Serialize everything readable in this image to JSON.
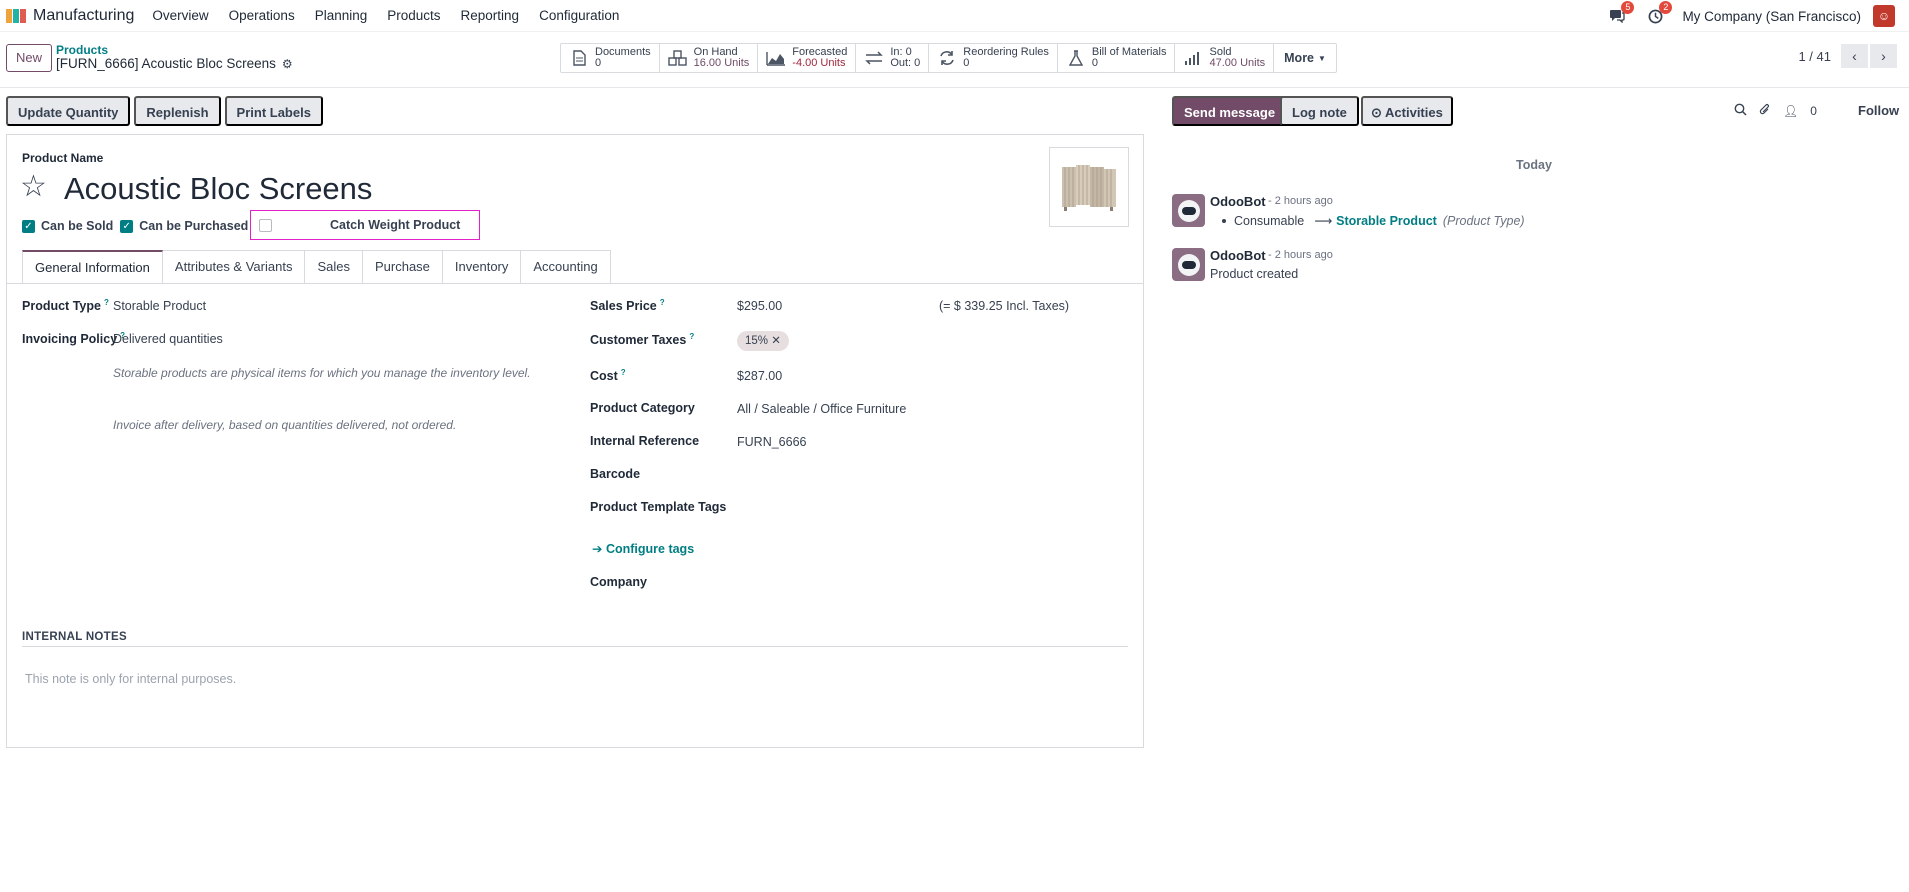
{
  "navbar": {
    "app_name": "Manufacturing",
    "menu": [
      "Overview",
      "Operations",
      "Planning",
      "Products",
      "Reporting",
      "Configuration"
    ],
    "messages_badge": "5",
    "activities_badge": "2",
    "company": "My Company (San Francisco)"
  },
  "control": {
    "new_label": "New",
    "breadcrumb_parent": "Products",
    "breadcrumb_current": "[FURN_6666] Acoustic Bloc Screens",
    "pager": "1 / 41",
    "smart_buttons": {
      "documents": {
        "label": "Documents",
        "value": "0"
      },
      "on_hand": {
        "label": "On Hand",
        "value": "16.00 Units"
      },
      "forecasted": {
        "label": "Forecasted",
        "value": "-4.00 Units"
      },
      "in_out": {
        "in": "In: 0",
        "out": "Out: 0"
      },
      "reordering": {
        "label": "Reordering Rules",
        "value": "0"
      },
      "bom": {
        "label": "Bill of Materials",
        "value": "0"
      },
      "sold": {
        "label": "Sold",
        "value": "47.00 Units"
      },
      "more": "More"
    }
  },
  "actions": {
    "update_quantity": "Update Quantity",
    "replenish": "Replenish",
    "print_labels": "Print Labels"
  },
  "form": {
    "product_name_label": "Product Name",
    "product_name": "Acoustic Bloc Screens",
    "can_be_sold": "Can be Sold",
    "can_be_purchased": "Can be Purchased",
    "catch_weight": "Catch Weight Product",
    "tabs": [
      "General Information",
      "Attributes & Variants",
      "Sales",
      "Purchase",
      "Inventory",
      "Accounting"
    ],
    "left": {
      "product_type_label": "Product Type",
      "product_type": "Storable Product",
      "invoicing_policy_label": "Invoicing Policy",
      "invoicing_policy": "Delivered quantities",
      "help1": "Storable products are physical items for which you manage the inventory level.",
      "help2": "Invoice after delivery, based on quantities delivered, not ordered."
    },
    "right": {
      "sales_price_label": "Sales Price",
      "sales_price": "$295.00",
      "incl_taxes": "(= $ 339.25 Incl. Taxes)",
      "customer_taxes_label": "Customer Taxes",
      "tax_tag": "15%",
      "cost_label": "Cost",
      "cost": "$287.00",
      "category_label": "Product Category",
      "category": "All / Saleable / Office Furniture",
      "internal_ref_label": "Internal Reference",
      "internal_ref": "FURN_6666",
      "barcode_label": "Barcode",
      "template_tags_label": "Product Template Tags",
      "configure_tags": "Configure tags",
      "company_label": "Company"
    },
    "notes_title": "INTERNAL NOTES",
    "notes_placeholder": "This note is only for internal purposes."
  },
  "chatter": {
    "send_message": "Send message",
    "log_note": "Log note",
    "activities": "Activities",
    "followers_count": "0",
    "follow": "Follow",
    "today": "Today",
    "messages": [
      {
        "author": "OdooBot",
        "time": "- 2 hours ago",
        "old": "Consumable",
        "new": "Storable Product",
        "field": "(Product Type)"
      },
      {
        "author": "OdooBot",
        "time": "- 2 hours ago",
        "body": "Product created"
      }
    ]
  },
  "colors": {
    "brand": "#714b67",
    "link": "#017e84",
    "highlight": "#e221c8"
  },
  "icons": [
    "manufacturing-logo",
    "chat-icon",
    "clock-icon",
    "gear-icon",
    "file-icon",
    "cubes-icon",
    "area-chart-icon",
    "exchange-icon",
    "refresh-icon",
    "flask-icon",
    "bar-chart-icon",
    "chevron-left-icon",
    "chevron-right-icon",
    "star-icon",
    "search-icon",
    "paperclip-icon",
    "user-icon"
  ]
}
